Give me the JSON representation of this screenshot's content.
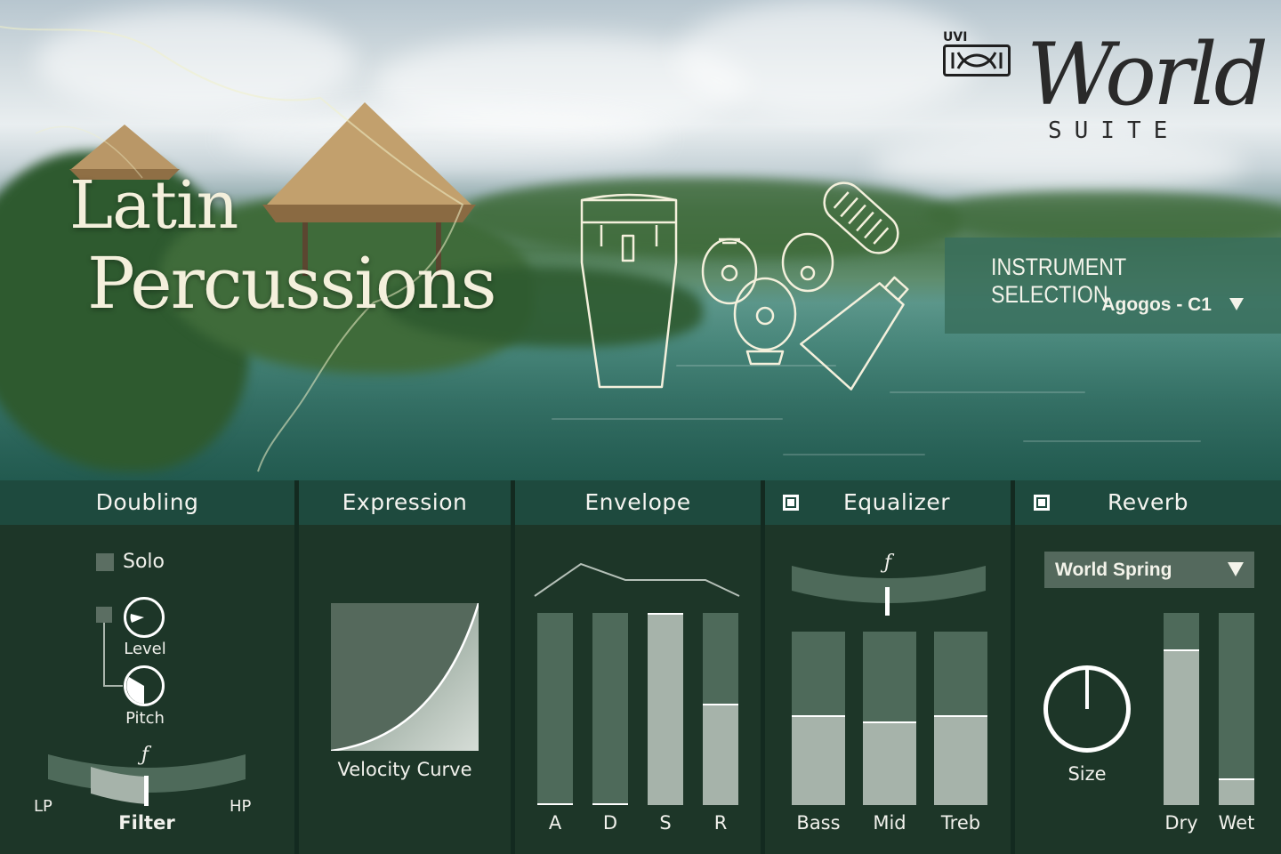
{
  "hero": {
    "title_line1": "Latin",
    "title_line2": "Percussions",
    "brand_uvi": "UVI",
    "brand_world": "World",
    "brand_suite": "SUITE"
  },
  "instrument": {
    "title": "INSTRUMENT SELECTION",
    "selected": "Agogos - C1"
  },
  "doubling": {
    "title": "Doubling",
    "solo_label": "Solo",
    "level_label": "Level",
    "pitch_label": "Pitch",
    "filter_symbol": "ƒ",
    "filter_label": "Filter",
    "lp_label": "LP",
    "hp_label": "HP",
    "level_value": 0.3,
    "pitch_value": 0.5,
    "filter_value": 0.5
  },
  "expression": {
    "title": "Expression",
    "curve_label": "Velocity Curve"
  },
  "envelope": {
    "title": "Envelope",
    "sliders": [
      {
        "label": "A",
        "value": 0.0
      },
      {
        "label": "D",
        "value": 0.0
      },
      {
        "label": "S",
        "value": 1.0
      },
      {
        "label": "R",
        "value": 0.53
      }
    ]
  },
  "equalizer": {
    "title": "Equalizer",
    "symbol": "ƒ",
    "enabled": true,
    "sliders": [
      {
        "label": "Bass",
        "value": 0.52
      },
      {
        "label": "Mid",
        "value": 0.48
      },
      {
        "label": "Treb",
        "value": 0.52
      }
    ]
  },
  "reverb": {
    "title": "Reverb",
    "enabled": true,
    "preset": "World Spring",
    "size_label": "Size",
    "size_value": 0.5,
    "sliders": [
      {
        "label": "Dry",
        "value": 0.81
      },
      {
        "label": "Wet",
        "value": 0.14
      }
    ]
  },
  "colors": {
    "panel_bg": "#1d3628",
    "header_bg": "#1e4a3e",
    "slider_track": "#4e6a5a",
    "slider_fill": "#a6b3aa",
    "cream": "#f4f0dc"
  }
}
